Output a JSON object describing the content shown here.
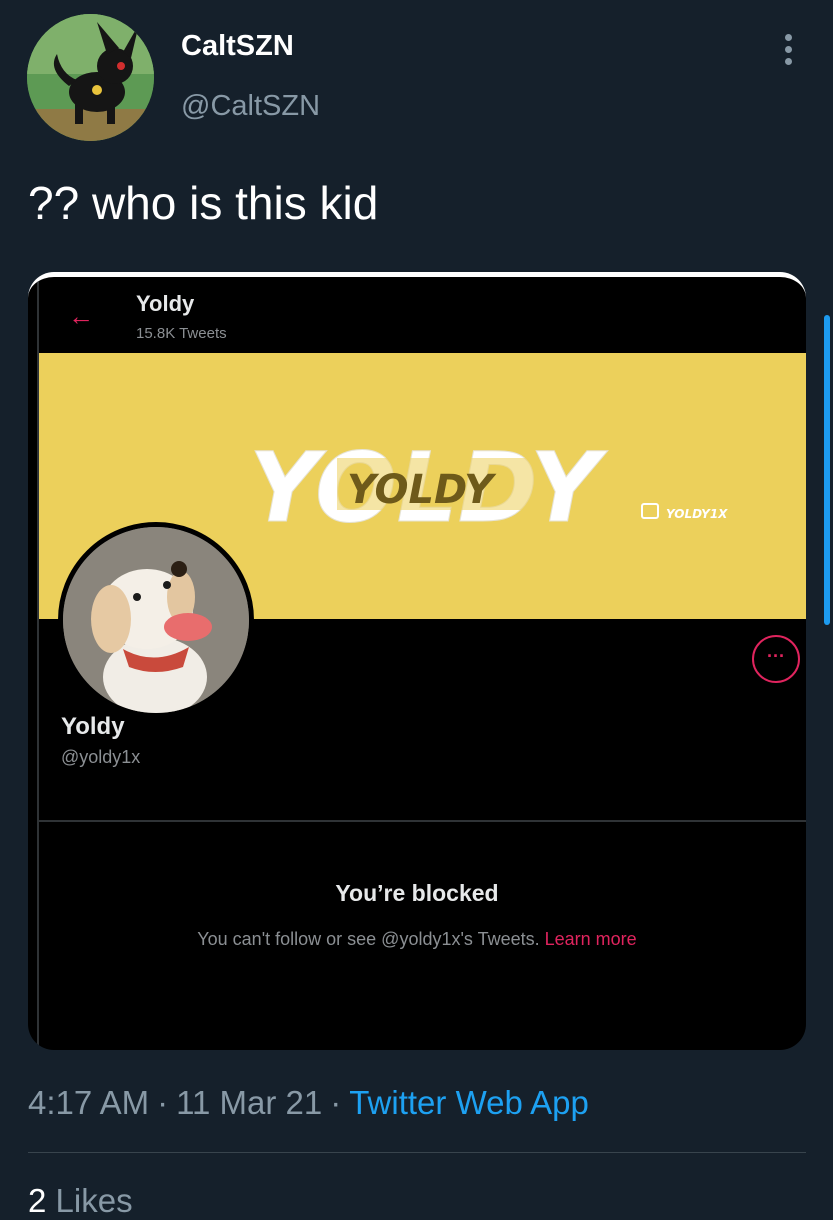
{
  "tweet": {
    "display_name": "CaltSZN",
    "handle": "@CaltSZN",
    "text": "?? who is this kid",
    "time": "4:17 AM",
    "date": "11 Mar 21",
    "source": "Twitter Web App",
    "likes_count": "2",
    "likes_label": "Likes",
    "separator": "·"
  },
  "screenshot": {
    "back_icon": "←",
    "name": "Yoldy",
    "tweet_count": "15.8K Tweets",
    "banner_big_text": "YOLDY",
    "banner_logo_text": "YOLDY",
    "banner_channel": "YOLDY1X",
    "more_button": "···",
    "profile_name": "Yoldy",
    "profile_handle": "@yoldy1x",
    "blocked_title": "You’re blocked",
    "blocked_text": "You can't follow or see @yoldy1x's Tweets.",
    "learn_more": "Learn more"
  },
  "colors": {
    "background": "#15202b",
    "accent": "#1da1f2",
    "banner": "#ecd05b",
    "screenshot_accent": "#e0245e"
  },
  "icons": {
    "more": "more-vertical-icon",
    "back": "arrow-left-icon",
    "twitch": "twitch-icon"
  }
}
